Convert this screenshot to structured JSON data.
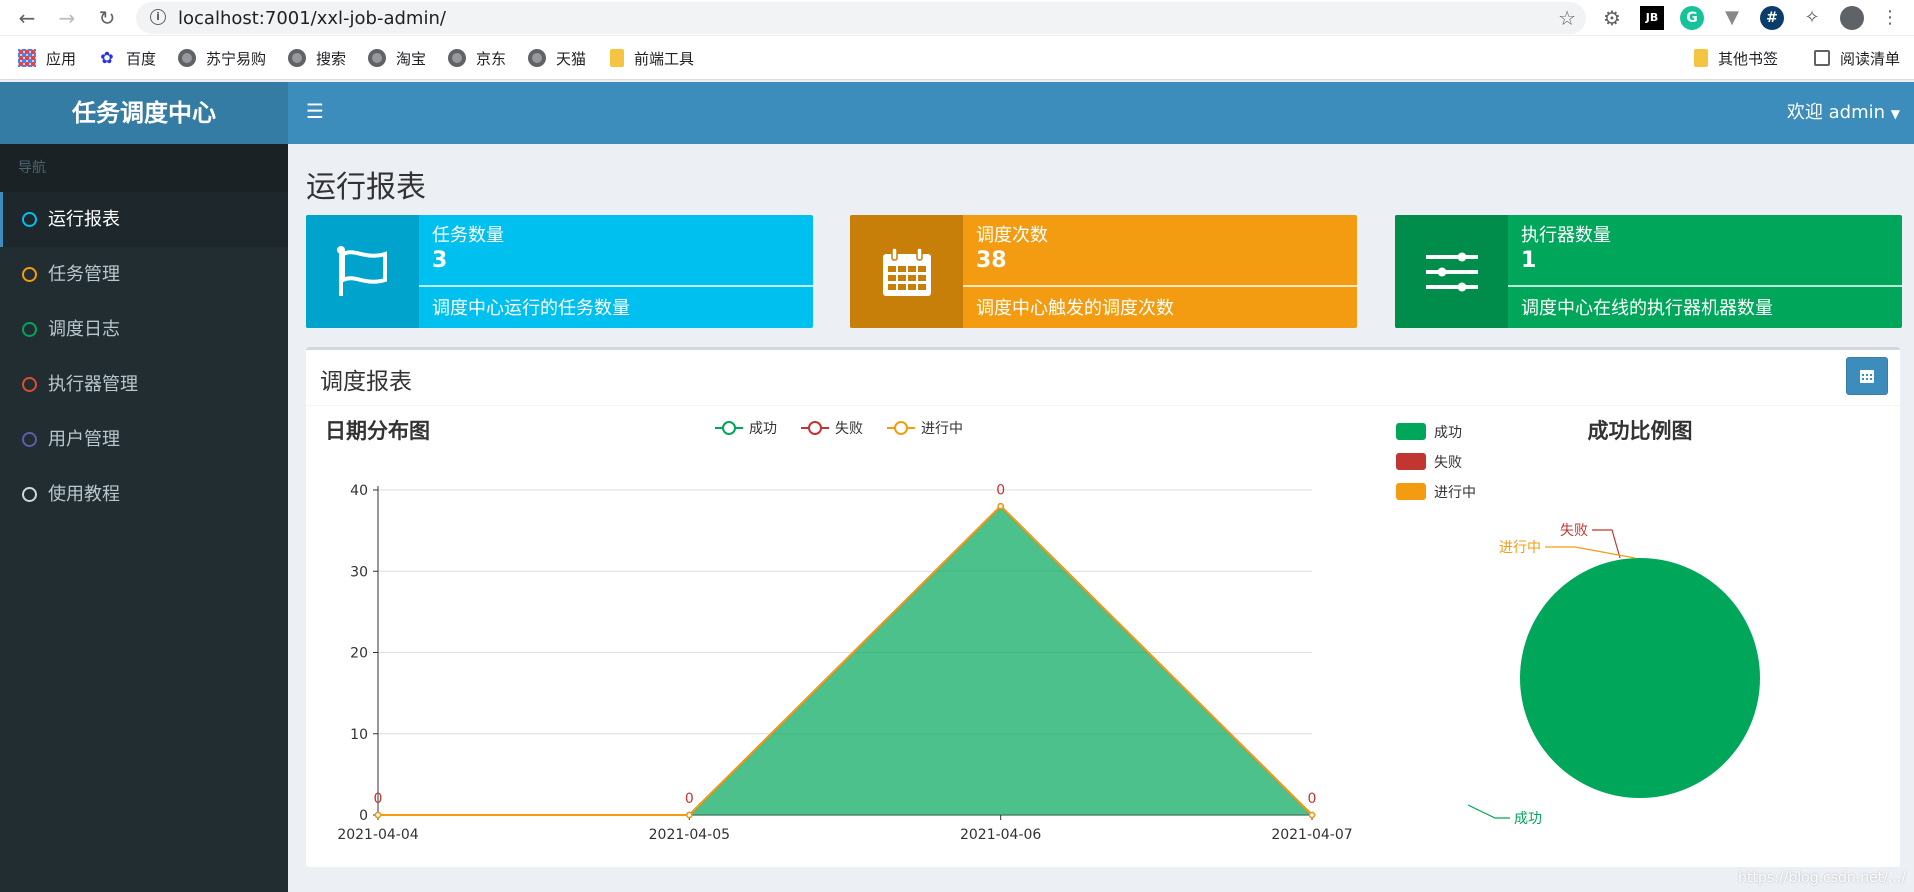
{
  "browser": {
    "url": "localhost:7001/xxl-job-admin/",
    "bookmarks": [
      {
        "label": "应用",
        "icon": "apps-grid-icon"
      },
      {
        "label": "百度",
        "icon": "baidu-paw-icon"
      },
      {
        "label": "苏宁易购",
        "icon": "globe-icon"
      },
      {
        "label": "搜索",
        "icon": "globe-icon"
      },
      {
        "label": "淘宝",
        "icon": "globe-icon"
      },
      {
        "label": "京东",
        "icon": "globe-icon"
      },
      {
        "label": "天猫",
        "icon": "globe-icon"
      },
      {
        "label": "前端工具",
        "icon": "folder-icon"
      }
    ],
    "other_bookmarks": "其他书签",
    "reading_list": "阅读清单",
    "extensions": {
      "jb": "JB",
      "grammarly": "G",
      "hash": "#"
    }
  },
  "app": {
    "logo": "任务调度中心",
    "user_greeting": "欢迎 admin"
  },
  "sidebar": {
    "header": "导航",
    "items": [
      {
        "label": "运行报表",
        "color": "#00c0ef",
        "active": true
      },
      {
        "label": "任务管理",
        "color": "#f39c12",
        "active": false
      },
      {
        "label": "调度日志",
        "color": "#00a65a",
        "active": false
      },
      {
        "label": "执行器管理",
        "color": "#dd4b39",
        "active": false
      },
      {
        "label": "用户管理",
        "color": "#605ca8",
        "active": false
      },
      {
        "label": "使用教程",
        "color": "#d2d6de",
        "active": false
      }
    ]
  },
  "page": {
    "title": "运行报表"
  },
  "info_boxes": [
    {
      "title": "任务数量",
      "value": "3",
      "desc": "调度中心运行的任务数量",
      "icon": "flag-icon",
      "color": "#00c0ef",
      "icon_bg": "#00a3cb"
    },
    {
      "title": "调度次数",
      "value": "38",
      "desc": "调度中心触发的调度次数",
      "icon": "calendar-icon",
      "color": "#f39c12",
      "icon_bg": "#c87f0a"
    },
    {
      "title": "执行器数量",
      "value": "1",
      "desc": "调度中心在线的执行器机器数量",
      "icon": "sliders-icon",
      "color": "#00a65a",
      "icon_bg": "#008d4c"
    }
  ],
  "report_panel": {
    "title": "调度报表"
  },
  "chart_data": [
    {
      "type": "area",
      "title": "日期分布图",
      "categories": [
        "2021-04-04",
        "2021-04-05",
        "2021-04-06",
        "2021-04-07"
      ],
      "series": [
        {
          "name": "成功",
          "values": [
            0,
            0,
            38,
            0
          ],
          "color": "#00a65a"
        },
        {
          "name": "失败",
          "values": [
            0,
            0,
            0,
            0
          ],
          "color": "#c23632"
        },
        {
          "name": "进行中",
          "values": [
            0,
            0,
            0,
            0
          ],
          "color": "#f39c12"
        }
      ],
      "ylim": [
        0,
        40
      ],
      "yticks": [
        0,
        10,
        20,
        30,
        40
      ],
      "data_labels": [
        "0",
        "0",
        "0",
        "0"
      ],
      "legend": "top-center",
      "grid": true
    },
    {
      "type": "pie",
      "title": "成功比例图",
      "slices": [
        {
          "name": "成功",
          "value": 38,
          "color": "#00a65a"
        },
        {
          "name": "失败",
          "value": 0,
          "color": "#c23632"
        },
        {
          "name": "进行中",
          "value": 0,
          "color": "#f39c12"
        }
      ],
      "legend": "top-left"
    }
  ],
  "watermark": "https://blog.csdn.net/.../"
}
